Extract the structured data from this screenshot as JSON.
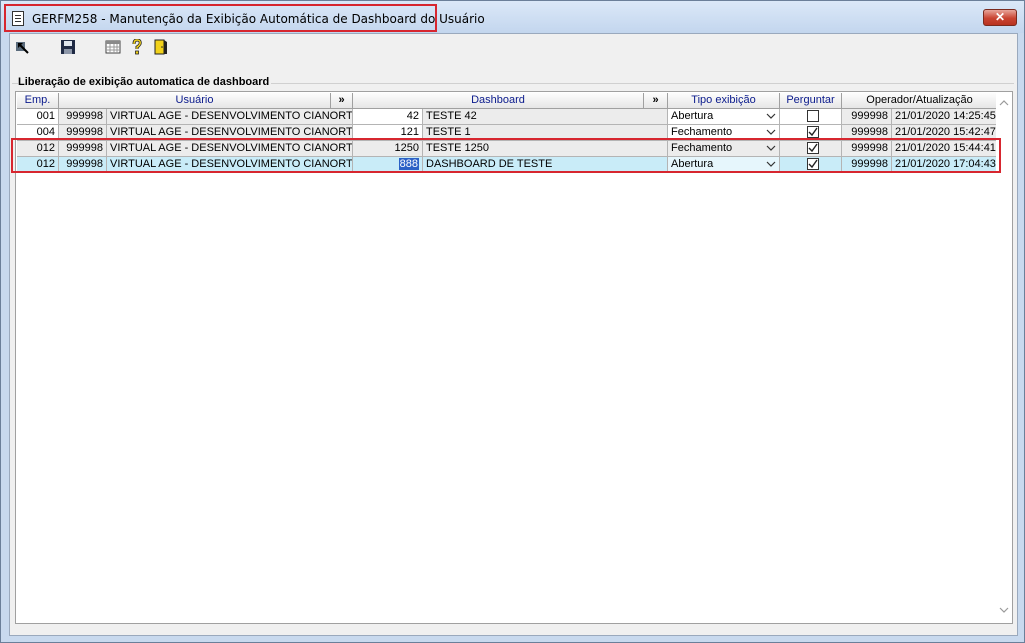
{
  "window": {
    "title": "GERFM258 - Manutenção da Exibição Automática de Dashboard do Usuário",
    "close_label": "✕"
  },
  "toolbar": {
    "icons": [
      "navigate-icon",
      "save-icon",
      "calendar-grid-icon",
      "help-icon",
      "exit-door-icon"
    ]
  },
  "group": {
    "title": "Liberação de exibição automatica de dashboard"
  },
  "grid": {
    "columns": {
      "emp": "Emp.",
      "usuario": "Usuário",
      "expand1": "»",
      "dashboard": "Dashboard",
      "expand2": "»",
      "tipo": "Tipo exibição",
      "perguntar": "Perguntar",
      "operador": "Operador/Atualização"
    },
    "rows": [
      {
        "emp": "001",
        "user_code": "999998",
        "user_name": "VIRTUAL AGE - DESENVOLVIMENTO CIANORTE",
        "dash_code": "42",
        "dash_name": "TESTE 42",
        "tipo": "Abertura",
        "perguntar": false,
        "operador": "999998",
        "atualizacao": "21/01/2020 14:25:45"
      },
      {
        "emp": "004",
        "user_code": "999998",
        "user_name": "VIRTUAL AGE - DESENVOLVIMENTO CIANORTE",
        "dash_code": "121",
        "dash_name": "TESTE 1",
        "tipo": "Fechamento",
        "perguntar": true,
        "operador": "999998",
        "atualizacao": "21/01/2020 15:42:47"
      },
      {
        "emp": "012",
        "user_code": "999998",
        "user_name": "VIRTUAL AGE - DESENVOLVIMENTO CIANORTE",
        "dash_code": "1250",
        "dash_name": "TESTE 1250",
        "tipo": "Fechamento",
        "perguntar": true,
        "operador": "999998",
        "atualizacao": "21/01/2020 15:44:41"
      },
      {
        "emp": "012",
        "user_code": "999998",
        "user_name": "VIRTUAL AGE - DESENVOLVIMENTO CIANORTE",
        "dash_code": "888",
        "dash_name": "DASHBOARD DE TESTE",
        "tipo": "Abertura",
        "perguntar": true,
        "operador": "999998",
        "atualizacao": "21/01/2020 17:04:43"
      }
    ]
  }
}
